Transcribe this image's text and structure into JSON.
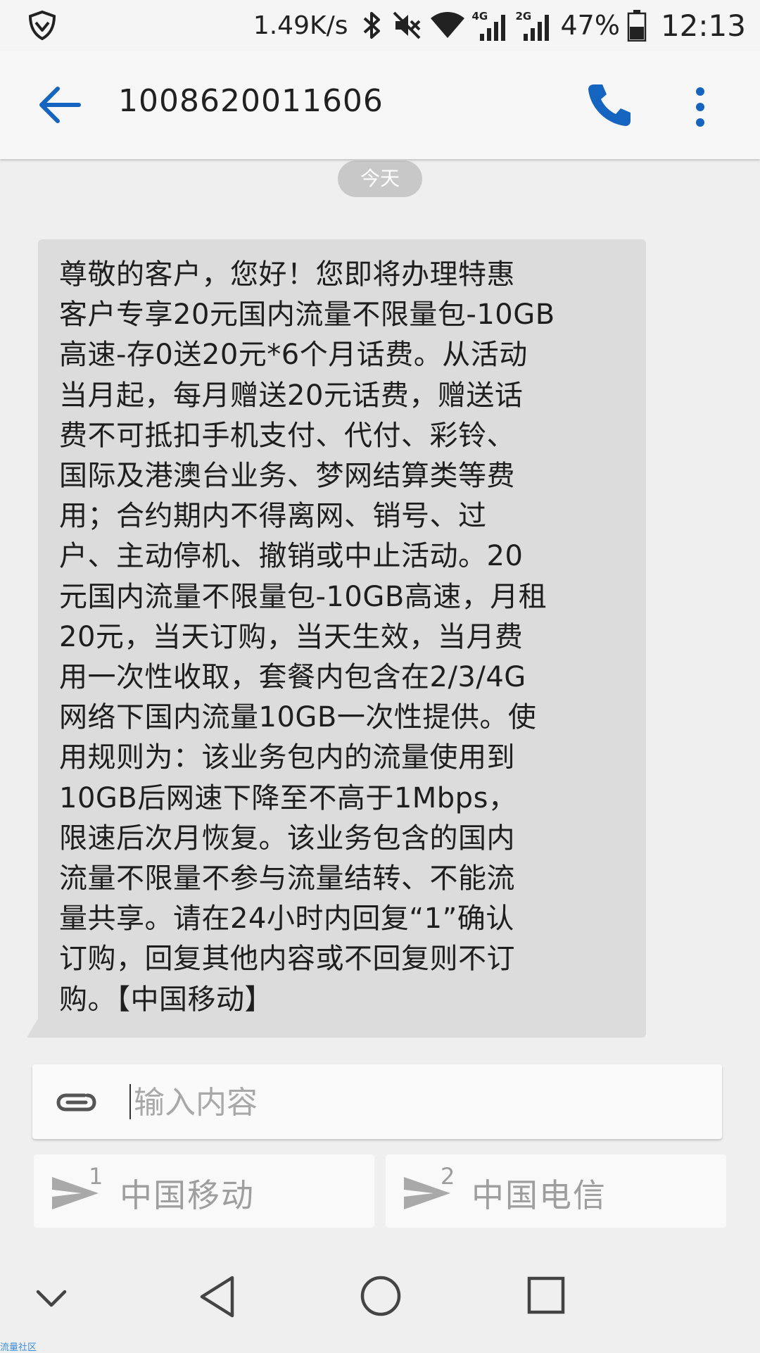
{
  "status_bar": {
    "speed": "1.49K/s",
    "net_1": "4G",
    "net_2": "2G",
    "battery": "47%",
    "time": "12:13"
  },
  "header": {
    "title": "1008620011606"
  },
  "date_chip": "今天",
  "message": {
    "lines": [
      "尊敬的客户，您好！您即将办理特惠",
      "客户专享20元国内流量不限量包-10GB",
      "高速-存0送20元*6个月话费。从活动",
      "当月起，每月赠送20元话费，赠送话",
      "费不可抵扣手机支付、代付、彩铃、",
      "国际及港澳台业务、梦网结算类等费",
      "用；合约期内不得离网、销号、过",
      "户、主动停机、撤销或中止活动。20",
      "元国内流量不限量包-10GB高速，月租",
      "20元，当天订购，当天生效，当月费",
      "用一次性收取，套餐内包含在2/3/4G",
      "网络下国内流量10GB一次性提供。使",
      "用规则为：该业务包内的流量使用到",
      "10GB后网速下降至不高于1Mbps，",
      "限速后次月恢复。该业务包含的国内",
      "流量不限量不参与流量结转、不能流",
      "量共享。请在24小时内回复“1”确认",
      "订购，回复其他内容或不回复则不订",
      "购。【中国移动】"
    ]
  },
  "input": {
    "placeholder": "输入内容"
  },
  "send_buttons": [
    {
      "sim": "1",
      "label": "中国移动"
    },
    {
      "sim": "2",
      "label": "中国电信"
    }
  ],
  "watermark": "流量社区",
  "colors": {
    "accent": "#1565c0",
    "bubble": "#dcdcdc",
    "background": "#efefef"
  },
  "icons": {
    "status": "shield-icon",
    "back": "arrow-back-icon",
    "call": "phone-icon",
    "menu": "more-vert-icon",
    "attach": "paperclip-icon",
    "send": "send-icon"
  }
}
